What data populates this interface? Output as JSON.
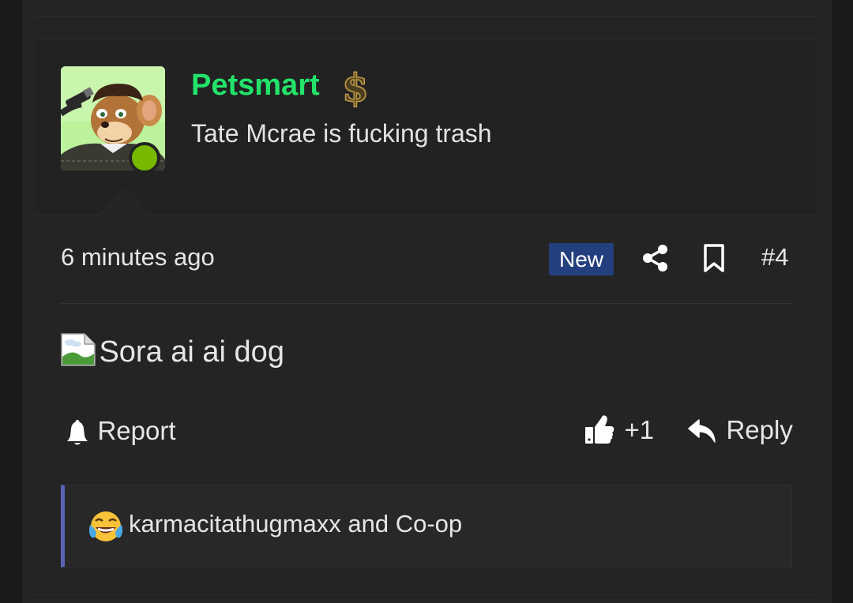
{
  "post": {
    "author": {
      "username": "Petsmart",
      "user_title": "Tate Mcrae is fucking trash",
      "badge_icon": "dollar-sign-icon",
      "username_color": "#22e46a",
      "online_status_color": "#76b900"
    },
    "meta": {
      "timestamp": "6 minutes ago",
      "new_badge": "New",
      "post_number": "#4"
    },
    "content": {
      "broken_image_alt": "Sora ai ai dog"
    },
    "actions": {
      "report_label": "Report",
      "reaction_count": "+1",
      "reply_label": "Reply"
    },
    "reactions": {
      "emoji_icon": "laughing-crying-emoji",
      "text": "karmacitathugmaxx and Co-op",
      "accent_color": "#5a63b8"
    }
  }
}
